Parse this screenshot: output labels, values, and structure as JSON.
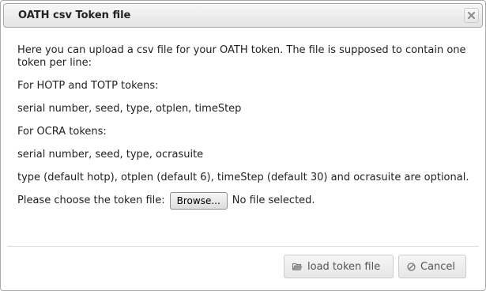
{
  "dialog": {
    "title": "OATH csv Token file",
    "close_label": "×"
  },
  "content": {
    "intro": "Here you can upload a csv file for your OATH token. The file is supposed to contain one token per line:",
    "hotp_heading": "For HOTP and TOTP tokens:",
    "hotp_format": "serial number, seed, type, otplen, timeStep",
    "ocra_heading": "For OCRA tokens:",
    "ocra_format": "serial number, seed, type, ocrasuite",
    "optional_note": "type (default hotp), otplen (default 6), timeStep (default 30) and ocrasuite are optional.",
    "file_prompt": "Please choose the token file:",
    "browse_label": "Browse...",
    "file_status": "No file selected."
  },
  "footer": {
    "load_label": "load token file",
    "load_icon": "folder-open-icon",
    "cancel_label": "Cancel",
    "cancel_icon": "cancel-circle-icon"
  }
}
